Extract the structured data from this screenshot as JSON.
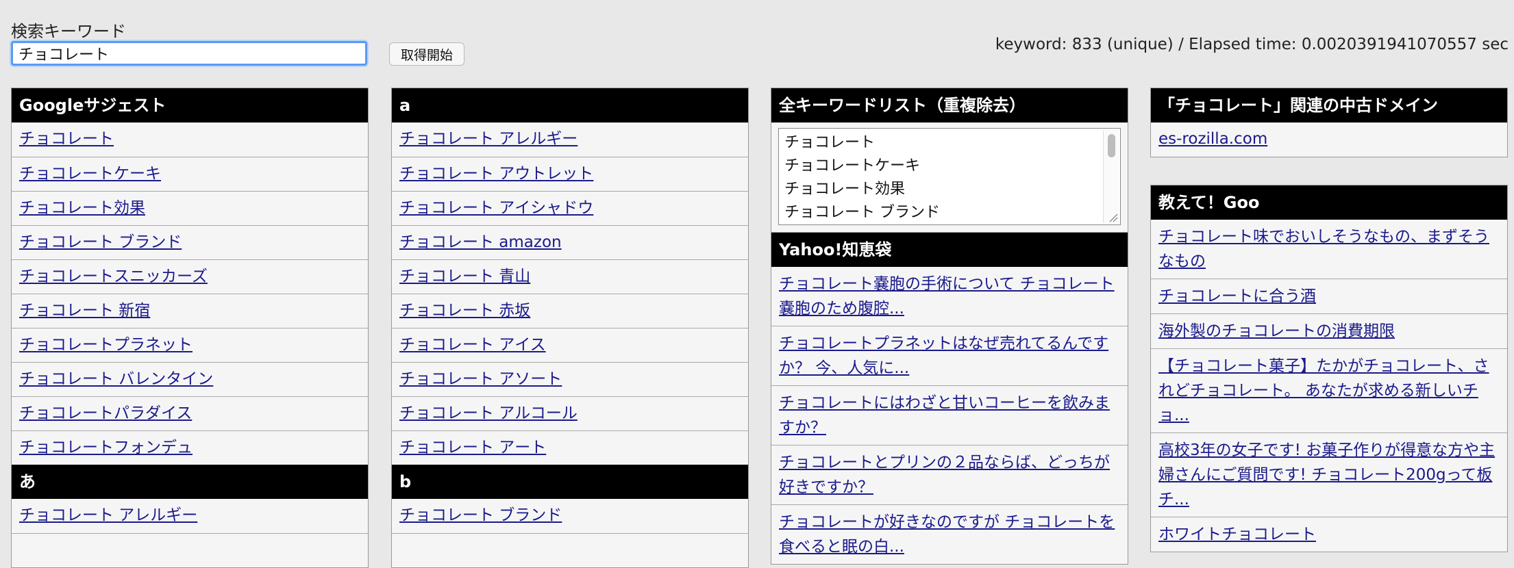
{
  "search": {
    "label": "検索キーワード",
    "value": "チョコレート",
    "button_label": "取得開始"
  },
  "stats": "keyword: 833 (unique) / Elapsed time: 0.0020391941070557 sec",
  "google": {
    "title": "Googleサジェスト",
    "items": [
      "チョコレート",
      "チョコレートケーキ",
      "チョコレート効果",
      "チョコレート ブランド",
      "チョコレートスニッカーズ",
      "チョコレート 新宿",
      "チョコレートプラネット",
      "チョコレート バレンタイン",
      "チョコレートパラダイス",
      "チョコレートフォンデュ"
    ]
  },
  "a_section": {
    "title": "あ",
    "items": [
      "チョコレート アレルギー"
    ]
  },
  "latin_a": {
    "title": "a",
    "items": [
      "チョコレート アレルギー",
      "チョコレート アウトレット",
      "チョコレート アイシャドウ",
      "チョコレート amazon",
      "チョコレート 青山",
      "チョコレート 赤坂",
      "チョコレート アイス",
      "チョコレート アソート",
      "チョコレート アルコール",
      "チョコレート アート"
    ]
  },
  "latin_b": {
    "title": "b",
    "items": [
      "チョコレート ブランド"
    ]
  },
  "keyword_list": {
    "title": "全キーワードリスト（重複除去）",
    "options": [
      "チョコレート",
      "チョコレートケーキ",
      "チョコレート効果",
      "チョコレート ブランド"
    ]
  },
  "yahoo": {
    "title": "Yahoo!知恵袋",
    "items": [
      "チョコレート嚢胞の手術について チョコレート嚢胞のため腹腔...",
      "チョコレートプラネットはなぜ売れてるんですか？ 今、人気に...",
      "チョコレートにはわざと甘いコーヒーを飲みますか？",
      "チョコレートとプリンの２品ならば、どっちが好きですか？",
      "チョコレートが好きなのですが チョコレートを食べると眠の白..."
    ]
  },
  "domains": {
    "title": "「チョコレート」関連の中古ドメイン",
    "items": [
      "es-rozilla.com"
    ]
  },
  "goo": {
    "title": "教えて！Goo",
    "items": [
      "チョコレート味でおいしそうなもの、まずそうなもの",
      "チョコレートに合う酒",
      "海外製のチョコレートの消費期限",
      "【チョコレート菓子】たかがチョコレート、されどチョコレート。 あなたが求める新しいチョ...",
      "高校3年の女子です! お菓子作りが得意な方や主婦さんにご質問です! チョコレート200gって板チ...",
      "ホワイトチョコレート"
    ]
  }
}
